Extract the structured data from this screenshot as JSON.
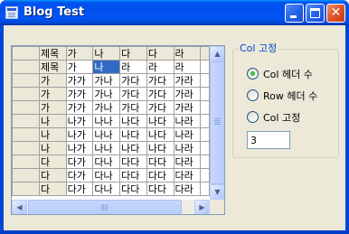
{
  "window": {
    "title": "Blog Test",
    "minimize_symbol": "",
    "maximize_symbol": "",
    "close_symbol": "✕"
  },
  "grid": {
    "rows": [
      [
        "",
        "제목",
        "가",
        "나",
        "다",
        "다",
        "라",
        ""
      ],
      [
        "",
        "제목",
        "가",
        "나",
        "라",
        "라",
        "라",
        ""
      ],
      [
        "",
        "가",
        "가가",
        "가나",
        "가다",
        "가다",
        "가라",
        ""
      ],
      [
        "",
        "가",
        "가가",
        "가나",
        "가다",
        "가다",
        "가라",
        ""
      ],
      [
        "",
        "가",
        "가가",
        "가나",
        "가다",
        "가다",
        "가라",
        ""
      ],
      [
        "",
        "나",
        "나가",
        "나나",
        "나다",
        "나다",
        "나라",
        ""
      ],
      [
        "",
        "나",
        "나가",
        "나나",
        "나다",
        "나다",
        "나라",
        ""
      ],
      [
        "",
        "나",
        "나가",
        "나나",
        "나다",
        "나다",
        "나라",
        ""
      ],
      [
        "",
        "다",
        "다가",
        "다나",
        "다다",
        "다다",
        "다라",
        ""
      ],
      [
        "",
        "다",
        "다가",
        "다나",
        "다다",
        "다다",
        "다라",
        ""
      ],
      [
        "",
        "다",
        "다가",
        "다나",
        "다다",
        "다다",
        "다라",
        ""
      ]
    ],
    "scroll_arrows": {
      "up": "▲",
      "down": "▼",
      "left": "◀",
      "right": "▶"
    }
  },
  "options": {
    "group_title": "Col 고정",
    "radios": [
      {
        "label": "Col 헤더 수",
        "checked": true
      },
      {
        "label": "Row 헤더 수",
        "checked": false
      },
      {
        "label": "Col 고정",
        "checked": false
      }
    ],
    "value_input": "3"
  },
  "colors": {
    "selection": "#316ac5",
    "group_title": "#0046d5",
    "titlebar": "#0053ee"
  }
}
